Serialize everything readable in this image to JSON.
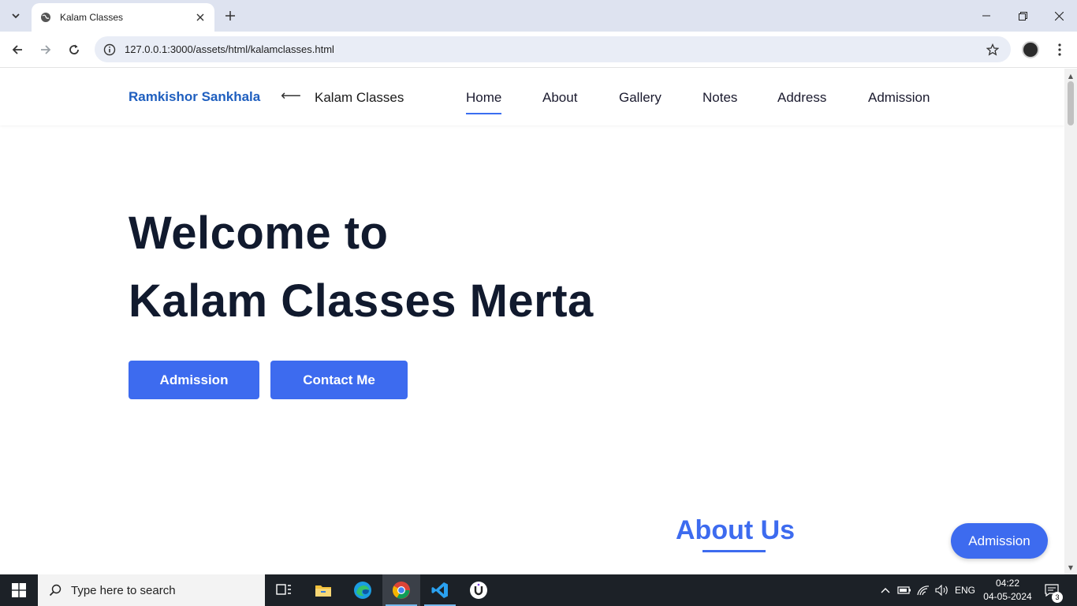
{
  "browser": {
    "tab_title": "Kalam Classes",
    "url": "127.0.0.1:3000/assets/html/kalamclasses.html",
    "icons": [
      "tab-search-icon",
      "globe-icon",
      "close-icon",
      "plus-icon",
      "minimize-icon",
      "restore-icon",
      "close-window-icon",
      "back-icon",
      "forward-icon",
      "reload-icon",
      "site-info-icon",
      "bookmark-star-icon",
      "profile-avatar",
      "more-menu-icon"
    ]
  },
  "site": {
    "brand": "Ramkishor Sankhala",
    "arrow": "⟵",
    "name": "Kalam Classes",
    "nav": [
      "Home",
      "About",
      "Gallery",
      "Notes",
      "Address",
      "Admission"
    ],
    "active_nav": "Home",
    "hero_line1": "Welcome to",
    "hero_line2": "Kalam Classes Merta",
    "btn_admission": "Admission",
    "btn_contact": "Contact Me",
    "about_title": "About Us",
    "float_admission": "Admission",
    "accent_color": "#3d6bef",
    "brand_color": "#1f5fbf",
    "heading_color": "#111a2e"
  },
  "taskbar": {
    "search_placeholder": "Type here to search",
    "language": "ENG",
    "time": "04:22",
    "date": "04-05-2024",
    "notification_count": "3"
  }
}
